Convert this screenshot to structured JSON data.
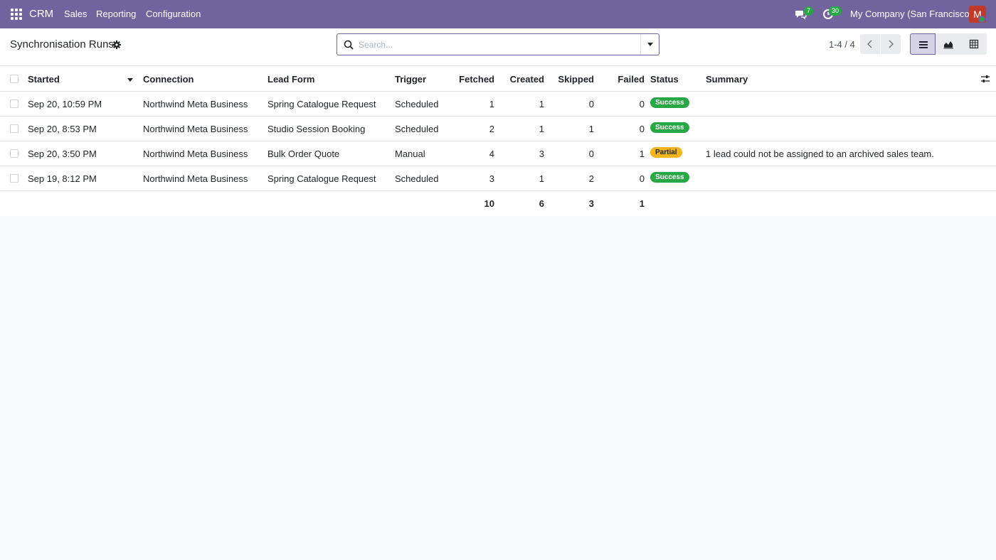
{
  "navbar": {
    "brand": "CRM",
    "menu": [
      "Sales",
      "Reporting",
      "Configuration"
    ],
    "messages_count": "7",
    "activities_count": "30",
    "company": "My Company (San Francisco)",
    "avatar_letter": "M"
  },
  "control_panel": {
    "title": "Synchronisation Runs",
    "search_placeholder": "Search...",
    "pager": "1-4 / 4"
  },
  "table": {
    "columns": [
      "Started",
      "Connection",
      "Lead Form",
      "Trigger",
      "Fetched",
      "Created",
      "Skipped",
      "Failed",
      "Status",
      "Summary"
    ],
    "rows": [
      {
        "started": "Sep 20, 10:59 PM",
        "connection": "Northwind Meta Business",
        "lead_form": "Spring Catalogue Request",
        "trigger": "Scheduled",
        "fetched": "1",
        "created": "1",
        "skipped": "0",
        "failed": "0",
        "status": "Success",
        "summary": ""
      },
      {
        "started": "Sep 20, 8:53 PM",
        "connection": "Northwind Meta Business",
        "lead_form": "Studio Session Booking",
        "trigger": "Scheduled",
        "fetched": "2",
        "created": "1",
        "skipped": "1",
        "failed": "0",
        "status": "Success",
        "summary": ""
      },
      {
        "started": "Sep 20, 3:50 PM",
        "connection": "Northwind Meta Business",
        "lead_form": "Bulk Order Quote",
        "trigger": "Manual",
        "fetched": "4",
        "created": "3",
        "skipped": "0",
        "failed": "1",
        "status": "Partial",
        "summary": "1 lead could not be assigned to an archived sales team."
      },
      {
        "started": "Sep 19, 8:12 PM",
        "connection": "Northwind Meta Business",
        "lead_form": "Spring Catalogue Request",
        "trigger": "Scheduled",
        "fetched": "3",
        "created": "1",
        "skipped": "2",
        "failed": "0",
        "status": "Success",
        "summary": ""
      }
    ],
    "totals": {
      "fetched": "10",
      "created": "6",
      "skipped": "3",
      "failed": "1"
    }
  },
  "colors": {
    "navbar": "#71639e",
    "success": "#28a745",
    "partial": "#f3b519"
  }
}
